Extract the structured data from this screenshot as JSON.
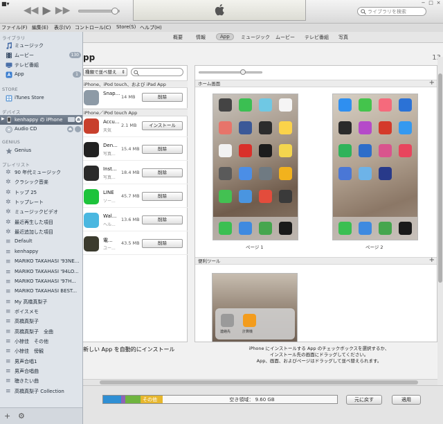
{
  "window": {
    "apple_logo": "apple-icon",
    "search_placeholder": "ライブラリを検索",
    "win_controls": [
      "−",
      "□",
      "×"
    ]
  },
  "menu": [
    "ファイル(F)",
    "編集(E)",
    "表示(V)",
    "コントロール(C)",
    "Store(S)",
    "ヘルプ(H)"
  ],
  "sidebar": {
    "library_head": "ライブラリ",
    "library": [
      {
        "label": "ミュージック",
        "icon": "music-note-icon"
      },
      {
        "label": "ムービー",
        "icon": "film-icon",
        "badge": "130"
      },
      {
        "label": "テレビ番組",
        "icon": "tv-icon"
      },
      {
        "label": "App",
        "icon": "app-icon",
        "badge": "1"
      }
    ],
    "store_head": "STORE",
    "store": [
      {
        "label": "iTunes Store",
        "icon": "itunes-store-icon"
      }
    ],
    "devices_head": "デバイス",
    "devices": [
      {
        "label": "kenhappy の iPhone",
        "icon": "iphone-icon"
      },
      {
        "label": "Audio CD",
        "icon": "cd-icon"
      }
    ],
    "genius_head": "GENIUS",
    "genius": [
      {
        "label": "Genius",
        "icon": "genius-icon"
      }
    ],
    "playlists_head": "プレイリスト",
    "playlists": [
      "90 年代ミュージック",
      "クラシック音楽",
      "トップ 25",
      "トップレート",
      "ミュージックビデオ",
      "最近再生した項目",
      "最近追加した項目",
      "Default",
      "kenhappy",
      "MARIKO TAKAHASI '93NE...",
      "MARIKO TAKAHASI '94LO...",
      "MARIKO TAKAHASI '97H...",
      "MARIKO TAKAHASI BEST...",
      "My 高橋真梨子",
      "ボイスメモ",
      "高橋真梨子",
      "高橋真梨子　全曲",
      "小椋佳　その他",
      "小椋佳　傍観",
      "男声合唱1",
      "男声合唱曲",
      "聴きたい曲",
      "高橋真梨子 Collection"
    ],
    "footer": [
      "+",
      "⚙"
    ]
  },
  "tabs": [
    "概要",
    "情報",
    "App",
    "ミュージック",
    "ムービー",
    "テレビ番組",
    "写真"
  ],
  "active_tab": "App",
  "page": {
    "title": "pp",
    "count": "13"
  },
  "apps_list": {
    "sort_label": "種類で並べ替え",
    "group1": "iPhone、iPod touch、および iPad App",
    "group2": "iPhone／iPod touch App",
    "apps": [
      {
        "name": "Snap...",
        "sub": "",
        "size": "14 MB",
        "button": "削除",
        "color": "#8d9aa6"
      },
      {
        "name": "Accu...",
        "sub": "天気",
        "size": "2.1 MB",
        "button": "インストール",
        "color": "#c8402d"
      },
      {
        "name": "Den...",
        "sub": "写真...",
        "size": "15.4 MB",
        "button": "削除",
        "color": "#222222"
      },
      {
        "name": "Inst...",
        "sub": "写真...",
        "size": "18.4 MB",
        "button": "削除",
        "color": "#2a2a2a"
      },
      {
        "name": "LINE",
        "sub": "ソー...",
        "size": "45.7 MB",
        "button": "削除",
        "color": "#1dc33b"
      },
      {
        "name": "Wal...",
        "sub": "ヘル...",
        "size": "13.6 MB",
        "button": "削除",
        "color": "#4ab7e0"
      },
      {
        "name": "電...",
        "sub": "ユー...",
        "size": "43.5 MB",
        "button": "削除",
        "color": "#3b3b2e"
      }
    ]
  },
  "home": {
    "head": "ホーム画面",
    "page1": "ページ 1",
    "page2": "ページ 2",
    "page1_icons": [
      "#444",
      "#3bbf52",
      "#6fc8e4",
      "#f5f5f5",
      "#e7746a",
      "#3b5998",
      "#2c2c2c",
      "#fbd34a",
      "#f2f2f2",
      "#d9302a",
      "#1c1c1c",
      "#f3d54e",
      "#5a5a5a",
      "#4b8ee6",
      "#6f7a82",
      "#f2b21d",
      "#43c152",
      "#4a95e0",
      "#e34c3c",
      "#3a3a3a"
    ],
    "page1_dock": [
      "#3bbf52",
      "#3f8ae0",
      "#46a64e",
      "#1a1a1a"
    ],
    "page2_icons": [
      "#2f8ff0",
      "#44c44c",
      "#f56a7c",
      "#2b72d6",
      "#2a2a2a",
      "#b54ac9",
      "#d43a2a",
      "#3499f0",
      "#2fb35a",
      "#2d6dc9",
      "#d9548d",
      "#e8455d",
      "#4a77d6",
      "#6db3e8",
      "#283a8a"
    ],
    "page2_dock": [
      "#3bbf52",
      "#3f8ae0",
      "#46a64e",
      "#1a1a1a"
    ]
  },
  "tools": {
    "head": "便利ツール",
    "folder_labels": [
      "連絡先",
      "計算機"
    ]
  },
  "auto_install_label": "新しい App を自動的にインストール",
  "instruction_lines": [
    "iPhone にインストールする App のチェックボックスを選択するか、",
    "インストール先の画面にドラッグしてください。",
    "App、画面、およびページはドラッグして並べ替えられます。"
  ],
  "capacity": {
    "other_label": "その他",
    "free_label": "空き領域： 9.60 GB"
  },
  "buttons": {
    "revert": "元に戻す",
    "apply": "適用"
  }
}
